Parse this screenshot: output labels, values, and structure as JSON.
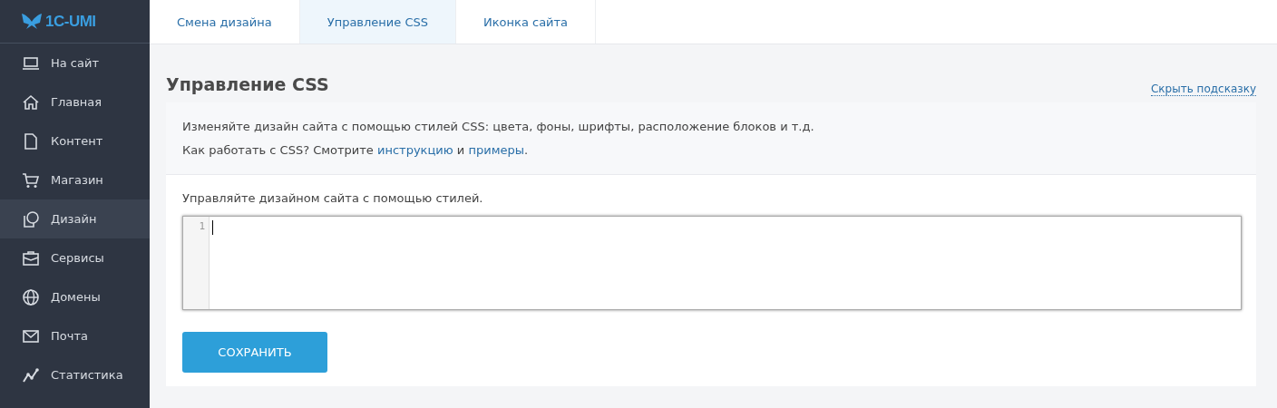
{
  "logo": {
    "text": "1C-UMI"
  },
  "sidebar": {
    "items": [
      {
        "label": "На сайт",
        "selected": false
      },
      {
        "label": "Главная",
        "selected": false
      },
      {
        "label": "Контент",
        "selected": false
      },
      {
        "label": "Магазин",
        "selected": false
      },
      {
        "label": "Дизайн",
        "selected": true
      },
      {
        "label": "Сервисы",
        "selected": false
      },
      {
        "label": "Домены",
        "selected": false
      },
      {
        "label": "Почта",
        "selected": false
      },
      {
        "label": "Статистика",
        "selected": false
      }
    ]
  },
  "tabs": [
    {
      "label": "Смена дизайна",
      "selected": false
    },
    {
      "label": "Управление CSS",
      "selected": true
    },
    {
      "label": "Иконка сайта",
      "selected": false
    }
  ],
  "page": {
    "title": "Управление CSS",
    "hide_hint_link": "Скрыть подсказку",
    "hint": {
      "line_1": "Изменяйте дизайн сайта с помощью стилей CSS: цвета, фоны, шрифты, расположение блоков и т.д.",
      "line_2_before": "Как работать с CSS? Смотрите",
      "link_1": "инструкцию",
      "between": "и",
      "link_2": "примеры",
      "after": "."
    },
    "editor_label": "Управляйте дизайном сайта с помощью стилей.",
    "editor": {
      "line_numbers": [
        "1"
      ]
    },
    "save_button": "СОХРАНИТЬ"
  }
}
